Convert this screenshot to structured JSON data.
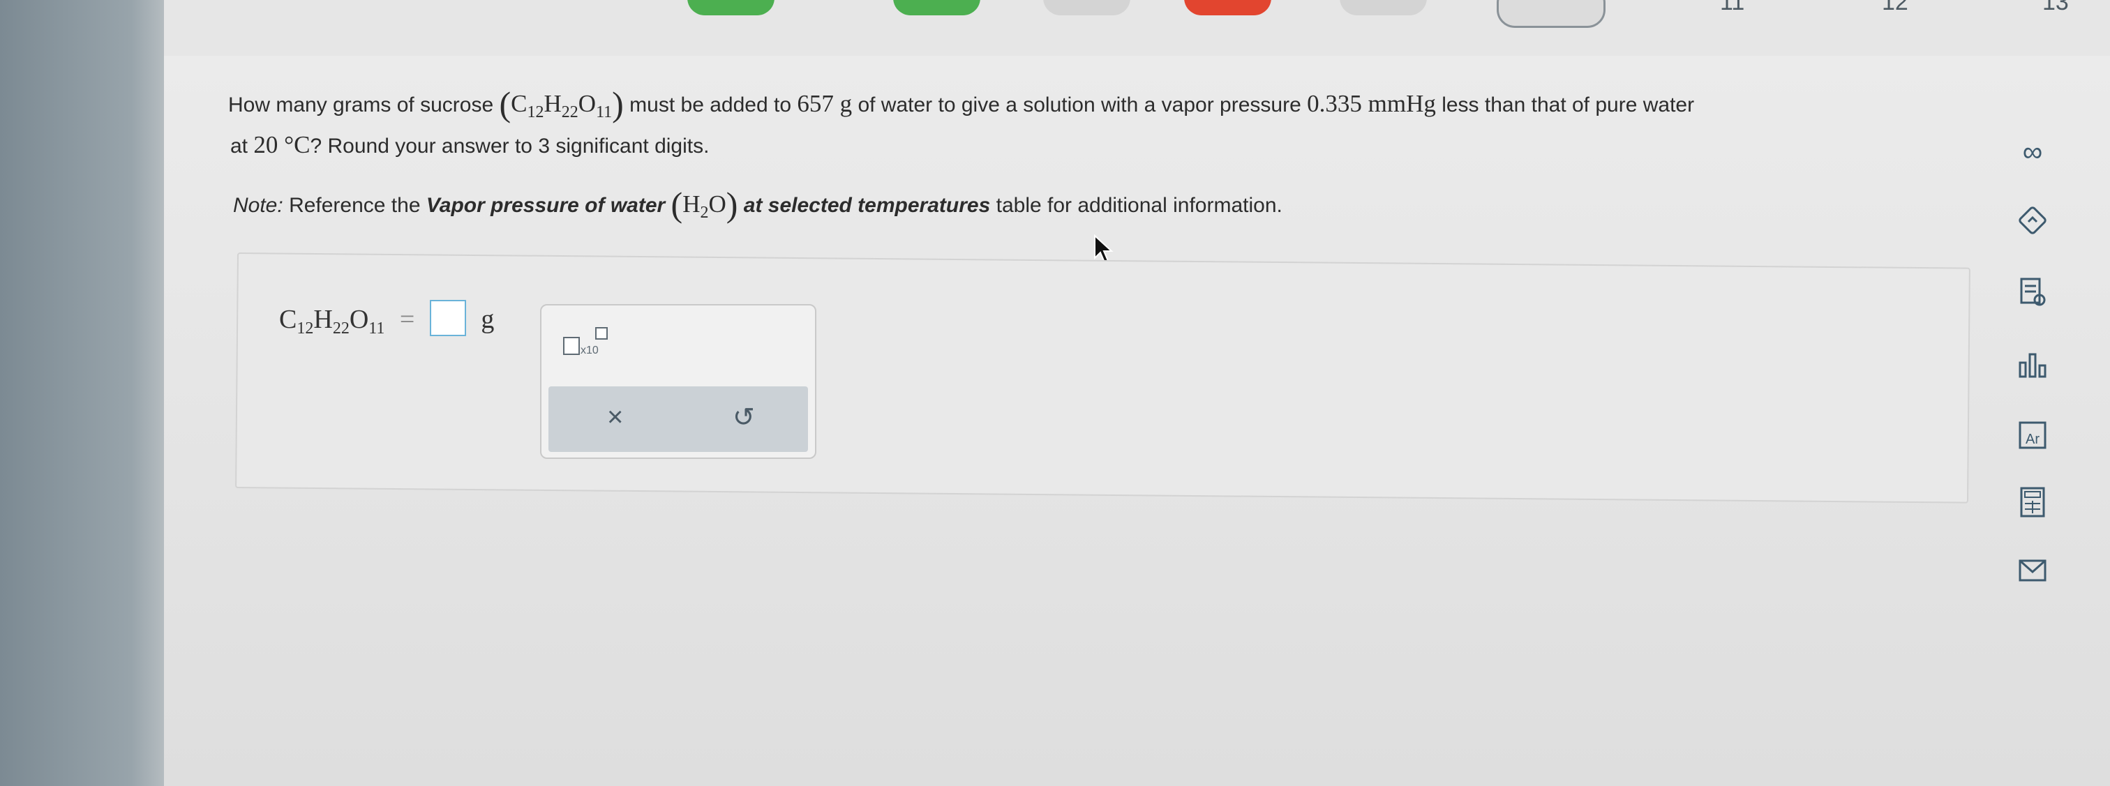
{
  "nav": {
    "question_numbers": [
      "11",
      "12",
      "13"
    ]
  },
  "question": {
    "line1_a": "How many grams of sucrose",
    "line1_b": "must be added to",
    "mass_value": "657 g",
    "line1_c": "of water to give a solution with a vapor pressure",
    "pressure_value": "0.335 mmHg",
    "line1_d": "less than that of pure water",
    "line2_a": "at",
    "temperature": "20 °C",
    "line2_b": "? Round your answer to 3 significant digits.",
    "note_label": "Note:",
    "note_a": "Reference the",
    "note_bold_a": "Vapor pressure of water",
    "note_bold_b": "at selected temperatures",
    "note_b": "table for additional information."
  },
  "formula": {
    "C": "C",
    "C_sub": "12",
    "H": "H",
    "H_sub": "22",
    "O": "O",
    "O_sub": "11",
    "water_H": "H",
    "water_H_sub": "2",
    "water_O": "O"
  },
  "answer": {
    "equals": "=",
    "unit": "g",
    "value": ""
  },
  "toolbox": {
    "sci_label": "x10",
    "clear_glyph": "×",
    "undo_glyph": "↺"
  },
  "colors": {
    "accent_green": "#4caf50",
    "accent_red": "#e2452f",
    "input_border": "#6ab3d9",
    "icon_blue": "#3d5a6e"
  }
}
